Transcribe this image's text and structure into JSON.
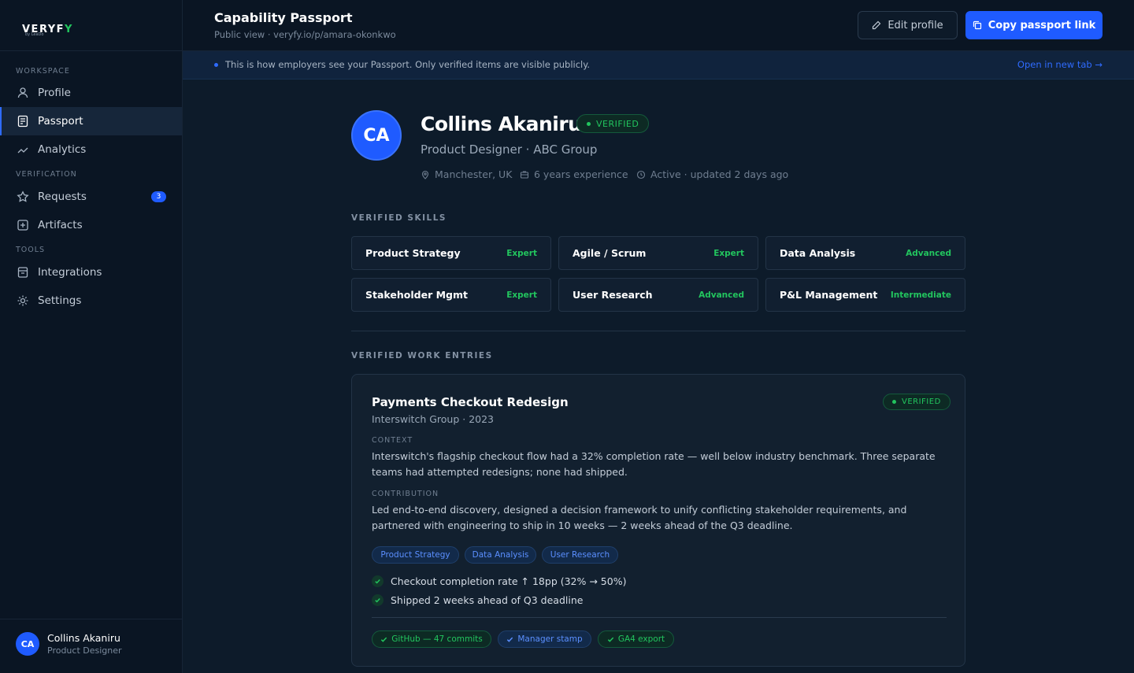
{
  "brand": {
    "logo_main": "VERYF",
    "logo_accent": "Y",
    "logo_sub": "by LeaDo"
  },
  "sidebar": {
    "sections": [
      "WORKSPACE",
      "VERIFICATION",
      "TOOLS"
    ],
    "items": [
      {
        "label": "Profile",
        "icon": "user-icon"
      },
      {
        "label": "Passport",
        "icon": "passport-icon",
        "active": true
      },
      {
        "label": "Analytics",
        "icon": "trend-icon"
      },
      {
        "label": "Requests",
        "icon": "star-icon",
        "badge": "3"
      },
      {
        "label": "Artifacts",
        "icon": "plus-box-icon"
      },
      {
        "label": "Integrations",
        "icon": "calendar-icon"
      },
      {
        "label": "Settings",
        "icon": "gear-icon"
      }
    ],
    "user": {
      "initials": "CA",
      "name": "Collins Akaniru",
      "role": "Product Designer"
    }
  },
  "header": {
    "title": "Capability Passport",
    "subtitle": "Public view · veryfy.io/p/amara-okonkwo",
    "edit_label": "Edit profile",
    "copy_label": "Copy passport link"
  },
  "banner": {
    "text": "This is how employers see your Passport. Only verified items are visible publicly.",
    "link": "Open in new tab →"
  },
  "profile": {
    "initials": "CA",
    "name": "Collins Akaniru",
    "verified_label": "VERIFIED",
    "role": "Product Designer · ABC Group",
    "location": "Manchester, UK",
    "experience": "6 years experience",
    "status": "Active · updated 2 days ago"
  },
  "skills_section": "VERIFIED SKILLS",
  "skills": [
    {
      "name": "Product Strategy",
      "level": "Expert"
    },
    {
      "name": "Agile / Scrum",
      "level": "Expert"
    },
    {
      "name": "Data Analysis",
      "level": "Advanced"
    },
    {
      "name": "Stakeholder Mgmt",
      "level": "Expert"
    },
    {
      "name": "User Research",
      "level": "Advanced"
    },
    {
      "name": "P&L Management",
      "level": "Intermediate"
    }
  ],
  "work_section": "VERIFIED WORK ENTRIES",
  "work": {
    "title": "Payments Checkout Redesign",
    "verified_label": "VERIFIED",
    "company": "Interswitch Group · 2023",
    "context_label": "CONTEXT",
    "context_text": "Interswitch's flagship checkout flow had a 32% completion rate — well below industry benchmark. Three separate teams had attempted redesigns; none had shipped.",
    "contribution_label": "CONTRIBUTION",
    "contribution_text": "Led end-to-end discovery, designed a decision framework to unify conflicting stakeholder requirements, and partnered with engineering to ship in 10 weeks — 2 weeks ahead of the Q3 deadline.",
    "tags": [
      "Product Strategy",
      "Data Analysis",
      "User Research"
    ],
    "outcomes": [
      "Checkout completion rate ↑ 18pp (32% → 50%)",
      "Shipped 2 weeks ahead of Q3 deadline"
    ],
    "evidence": [
      "GitHub — 47 commits",
      "Manager stamp",
      "GA4 export"
    ]
  },
  "colors": {
    "accent": "#1f5bff",
    "verified": "#22c55e",
    "background": "#0d1b2a"
  }
}
